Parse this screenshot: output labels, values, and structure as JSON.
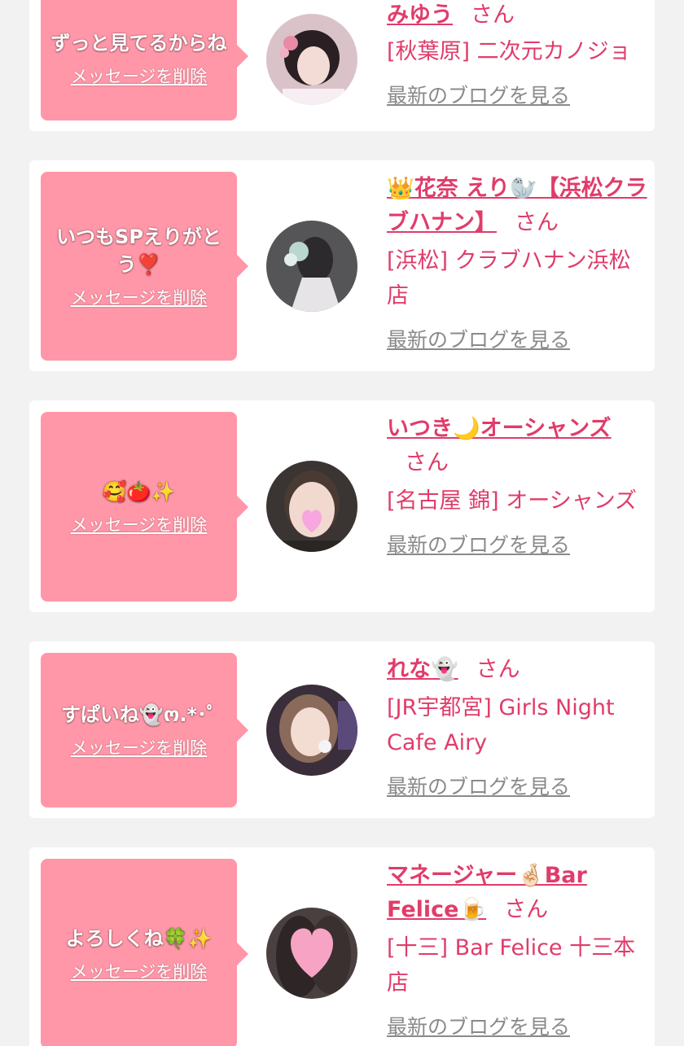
{
  "items": [
    {
      "message": "ずっと見てるからね",
      "delete_label": "メッセージを削除",
      "name": "みゆう",
      "honorific": "さん",
      "shop": "[秋葉原] 二次元カノジョ",
      "blog_label": "最新のブログを見る"
    },
    {
      "message": "いつもSPえりがとう❣️",
      "delete_label": "メッセージを削除",
      "name": "👑花奈 えり🦭【浜松クラブハナン】",
      "honorific": "さん",
      "shop": "[浜松] クラブハナン浜松店",
      "blog_label": "最新のブログを見る"
    },
    {
      "message": "🥰🍅✨",
      "delete_label": "メッセージを削除",
      "name": "いつき🌙オーシャンズ",
      "honorific": "さん",
      "shop": "[名古屋 錦] オーシャンズ",
      "blog_label": "最新のブログを見る"
    },
    {
      "message": "すぱいね👻ო.*･ﾟ",
      "delete_label": "メッセージを削除",
      "name": "れな👻",
      "honorific": "さん",
      "shop": "[JR宇都宮] Girls Night Cafe Airy",
      "blog_label": "最新のブログを見る"
    },
    {
      "message": "よろしくね🍀✨",
      "delete_label": "メッセージを削除",
      "name": "マネージャー🤞🏻Bar Felice🍺",
      "honorific": "さん",
      "shop": "[十三] Bar Felice 十三本店",
      "blog_label": "最新のブログを見る"
    }
  ],
  "colors": {
    "page_background": "#f2f2f2",
    "card_background": "#ffffff",
    "bubble_pink": "#ff97a8",
    "name_pink": "#e03c6a",
    "link_gray": "#8a8a8a"
  }
}
